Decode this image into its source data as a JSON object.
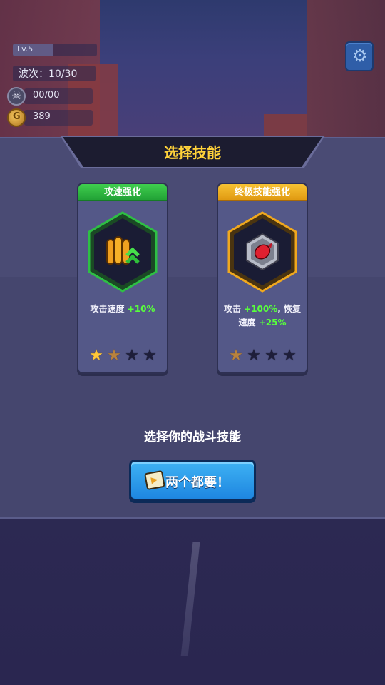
{
  "hud": {
    "level": "Lv.5",
    "level_progress": 0.48,
    "wave": "波次：10/30",
    "kills": "00/00",
    "coins": "389",
    "icons": [
      "skull-icon",
      "coin-icon",
      "gear-icon"
    ]
  },
  "panel": {
    "title": "选择技能",
    "subtitle": "选择你的战斗技能",
    "button_label": "两个都要！"
  },
  "cards": [
    {
      "name": "攻速强化",
      "header_color": "#2ebd45",
      "icon": "bullets-upgrade-icon",
      "desc_prefix": "攻击速度 ",
      "desc_value": "+10%",
      "desc_line2_prefix": "",
      "desc_line2_value": "",
      "stars_filled": 1,
      "stars_total": 4
    },
    {
      "name": "终极技能强化",
      "header_color": "#f2ae22",
      "icon": "bomb-icon",
      "desc_prefix": "攻击 ",
      "desc_value": "+100%",
      "desc_mid": ", 恢复",
      "desc_line2_prefix": "速度 ",
      "desc_line2_value": "+25%",
      "stars_filled": 0,
      "stars_total": 4
    }
  ]
}
